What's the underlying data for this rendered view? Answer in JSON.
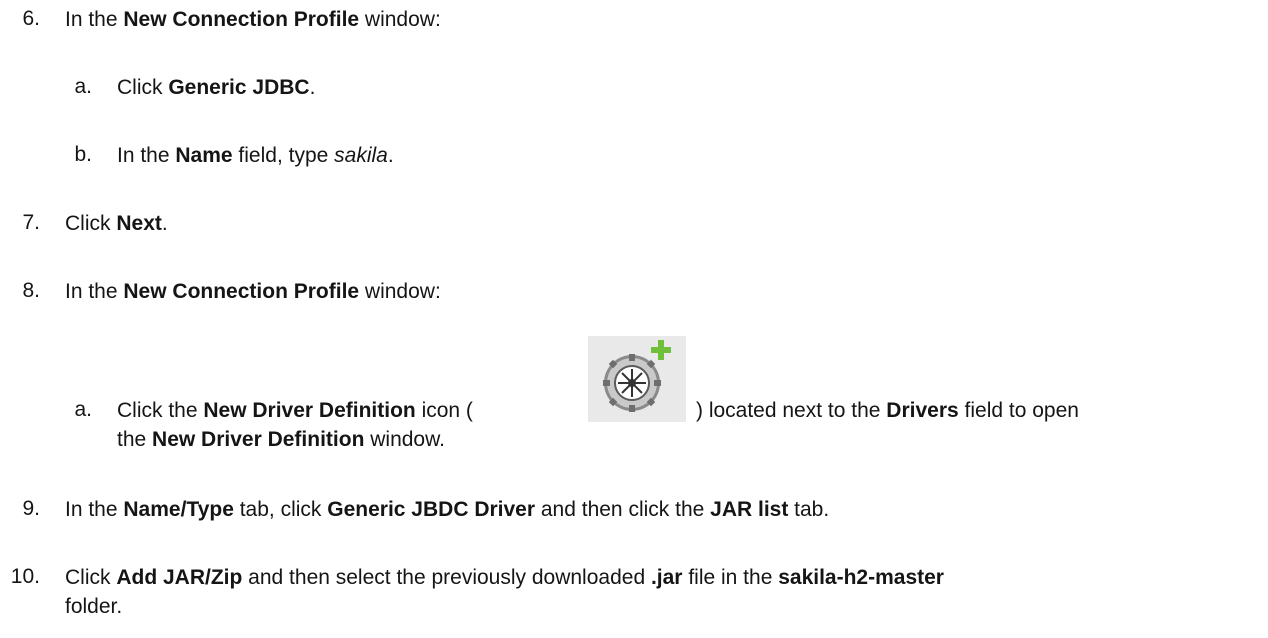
{
  "steps": {
    "s6": {
      "num": "6.",
      "pre": "In the ",
      "bold": "New Connection Profile",
      "post": " window:"
    },
    "s6a": {
      "num": "a.",
      "pre": "Click ",
      "bold": "Generic JDBC",
      "post": "."
    },
    "s6b": {
      "num": "b.",
      "pre": "In the ",
      "bold": "Name",
      "mid": " field, type ",
      "italic": "sakila",
      "post": "."
    },
    "s7": {
      "num": "7.",
      "pre": "Click ",
      "bold": "Next",
      "post": "."
    },
    "s8": {
      "num": "8.",
      "pre": "In the ",
      "bold": "New Connection Profile",
      "post": " window:"
    },
    "s8a": {
      "num": "a.",
      "pre": "Click the ",
      "bold1": "New Driver Definition",
      "mid1": " icon (",
      "mid2": ") located next to the ",
      "bold2": "Drivers",
      "post1": " field to open",
      "line2_pre": "the ",
      "bold3": "New Driver Definition",
      "line2_post": " window."
    },
    "s9": {
      "num": "9.",
      "pre": "In the ",
      "bold1": "Name/Type",
      "mid1": " tab, click ",
      "bold2": "Generic JBDC Driver",
      "mid2": " and then click the ",
      "bold3": "JAR list",
      "post": " tab."
    },
    "s10": {
      "num": "10.",
      "pre": "Click ",
      "bold1": "Add JAR/Zip",
      "mid1": " and then select the previously downloaded ",
      "bold2": ".jar",
      "mid2": " file in the ",
      "bold3": "sakila-h2-master",
      "line2": "folder."
    }
  },
  "icons": {
    "driver": "new-driver-definition-icon"
  }
}
